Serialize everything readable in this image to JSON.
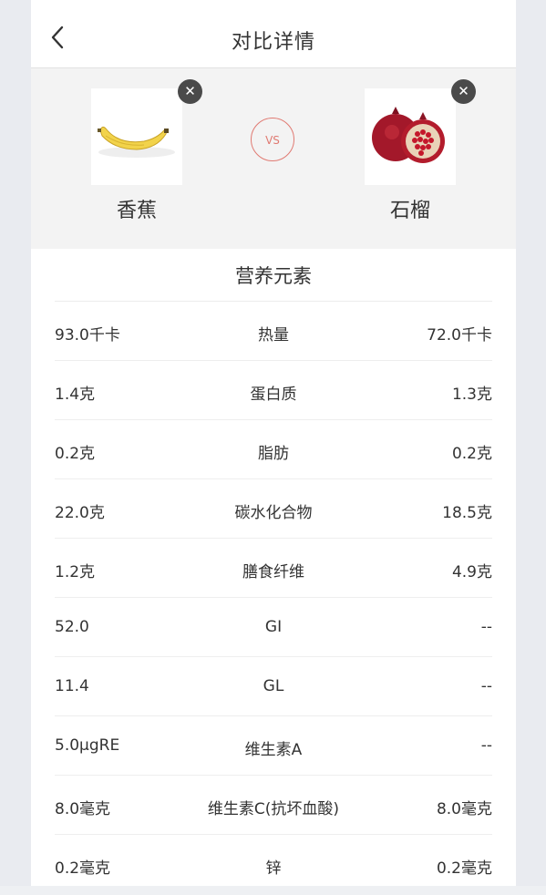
{
  "header": {
    "title": "对比详情",
    "back_icon": "chevron-left-icon"
  },
  "compare": {
    "left_food": {
      "name": "香蕉",
      "remove_label": "✕"
    },
    "right_food": {
      "name": "石榴",
      "remove_label": "✕"
    },
    "vs_label": "VS"
  },
  "nutrition": {
    "section_title": "营养元素",
    "rows": [
      {
        "left": "93.0千卡",
        "name": "热量",
        "right": "72.0千卡"
      },
      {
        "left": "1.4克",
        "name": "蛋白质",
        "right": "1.3克"
      },
      {
        "left": "0.2克",
        "name": "脂肪",
        "right": "0.2克"
      },
      {
        "left": "22.0克",
        "name": "碳水化合物",
        "right": "18.5克"
      },
      {
        "left": "1.2克",
        "name": "膳食纤维",
        "right": "4.9克"
      },
      {
        "left": "52.0",
        "name": "GI",
        "right": "--"
      },
      {
        "left": "11.4",
        "name": "GL",
        "right": "--"
      },
      {
        "left": "5.0μgRE",
        "name": "维生素A",
        "right": "--"
      },
      {
        "left": "8.0毫克",
        "name": "维生素C(抗坏血酸)",
        "right": "8.0毫克"
      },
      {
        "left": "0.2毫克",
        "name": "锌",
        "right": "0.2毫克"
      }
    ]
  },
  "colors": {
    "accent": "#e07a72",
    "text": "#333333",
    "background": "#e9ebf0"
  }
}
